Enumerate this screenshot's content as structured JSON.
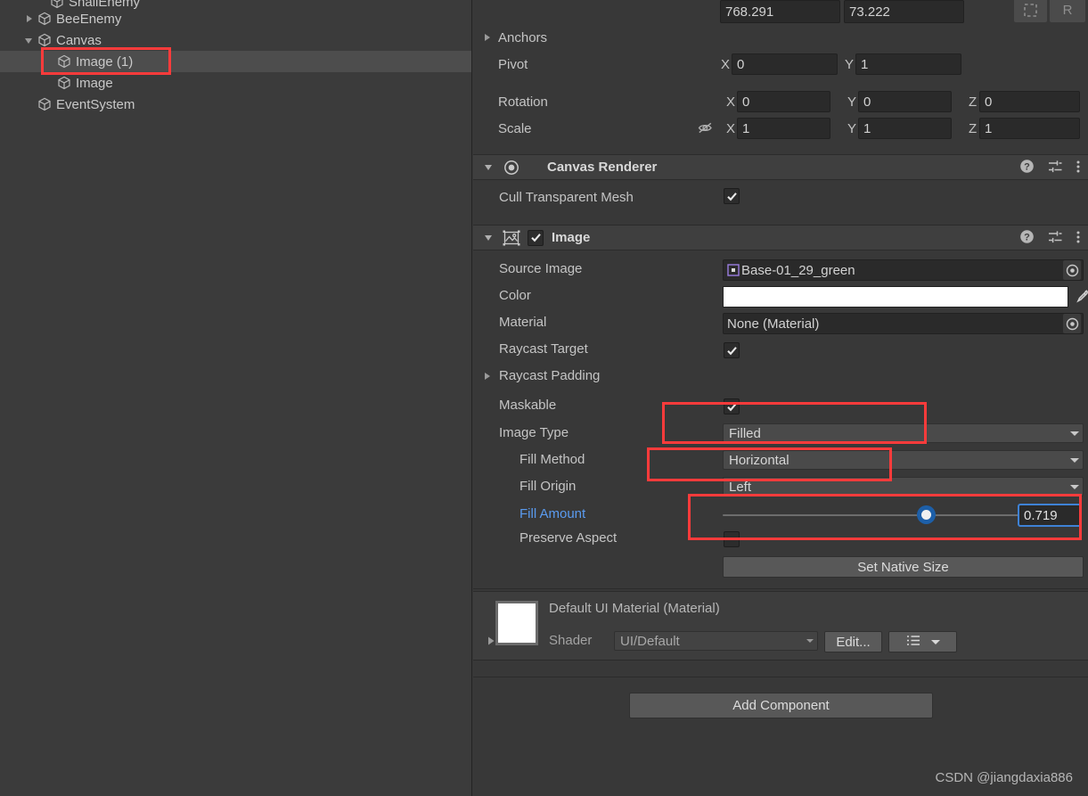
{
  "hierarchy": {
    "items": [
      {
        "label": "SnailEnemy",
        "indent": 1,
        "twisty": "none",
        "selected": false,
        "clipped": true
      },
      {
        "label": "BeeEnemy",
        "indent": 1,
        "twisty": "right",
        "selected": false,
        "clipped": false
      },
      {
        "label": "Canvas",
        "indent": 1,
        "twisty": "down",
        "selected": false,
        "clipped": false
      },
      {
        "label": "Image (1)",
        "indent": 2,
        "twisty": "none",
        "selected": true,
        "clipped": false
      },
      {
        "label": "Image",
        "indent": 2,
        "twisty": "none",
        "selected": false,
        "clipped": false
      },
      {
        "label": "EventSystem",
        "indent": 1,
        "twisty": "none",
        "selected": false,
        "clipped": false
      }
    ]
  },
  "inspector": {
    "rect_transform": {
      "width_value": "768.291",
      "height_value": "73.222",
      "blueprint_icon": "blueprint-mode-icon",
      "raw_label": "R",
      "anchors_label": "Anchors",
      "pivot_label": "Pivot",
      "pivot_x_axis": "X",
      "pivot_x": "0",
      "pivot_y_axis": "Y",
      "pivot_y": "1",
      "rotation_label": "Rotation",
      "rotation_x_axis": "X",
      "rotation_x": "0",
      "rotation_y_axis": "Y",
      "rotation_y": "0",
      "rotation_z_axis": "Z",
      "rotation_z": "0",
      "scale_label": "Scale",
      "scale_x_axis": "X",
      "scale_x": "1",
      "scale_y_axis": "Y",
      "scale_y": "1",
      "scale_z_axis": "Z",
      "scale_z": "1"
    },
    "canvas_renderer": {
      "title": "Canvas Renderer",
      "cull_label": "Cull Transparent Mesh",
      "cull_checked": true
    },
    "image": {
      "title": "Image",
      "enabled": true,
      "source_image_label": "Source Image",
      "source_image_value": "Base-01_29_green",
      "color_label": "Color",
      "color_value": "#FFFFFF",
      "material_label": "Material",
      "material_value": "None (Material)",
      "raycast_target_label": "Raycast Target",
      "raycast_target_checked": true,
      "raycast_padding_label": "Raycast Padding",
      "maskable_label": "Maskable",
      "maskable_checked": true,
      "image_type_label": "Image Type",
      "image_type_value": "Filled",
      "fill_method_label": "Fill Method",
      "fill_method_value": "Horizontal",
      "fill_origin_label": "Fill Origin",
      "fill_origin_value": "Left",
      "fill_amount_label": "Fill Amount",
      "fill_amount_value": "0.719",
      "fill_amount_ratio": 0.719,
      "preserve_aspect_label": "Preserve Aspect",
      "preserve_aspect_checked": false,
      "set_native_size_label": "Set Native Size"
    },
    "material_preview": {
      "title": "Default UI Material (Material)",
      "shader_label": "Shader",
      "shader_value": "UI/Default",
      "edit_label": "Edit...",
      "swatch_color": "#FFFFFF"
    },
    "add_component_label": "Add Component"
  },
  "watermark": "CSDN @jiangdaxia886",
  "colors": {
    "accent_blue": "#5a9bf0",
    "annotation_red": "#fb3b3b",
    "panel_bg": "#383838",
    "header_bg": "#3f3f3f",
    "selection_bg": "#4d4d4d"
  }
}
